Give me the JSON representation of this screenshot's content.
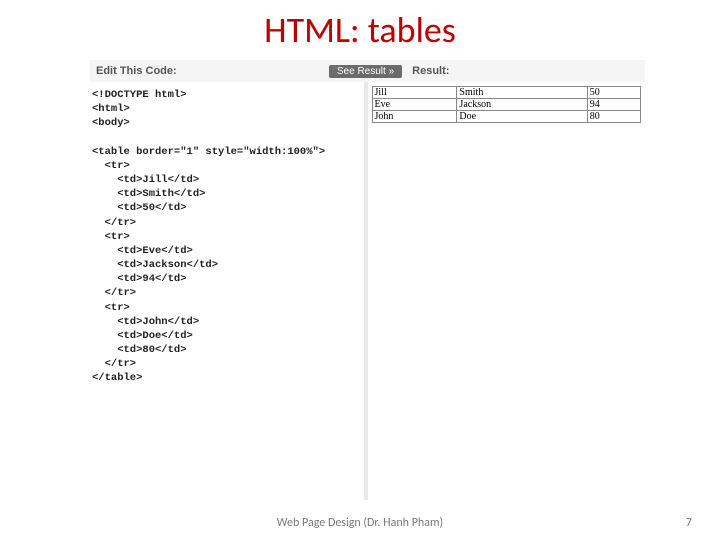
{
  "title": "HTML: tables",
  "labels": {
    "edit": "Edit This Code:",
    "see_result": "See Result »",
    "result": "Result:"
  },
  "code": "<!DOCTYPE html>\n<html>\n<body>\n\n<table border=\"1\" style=\"width:100%\">\n  <tr>\n    <td>Jill</td>\n    <td>Smith</td>\n    <td>50</td>\n  </tr>\n  <tr>\n    <td>Eve</td>\n    <td>Jackson</td>\n    <td>94</td>\n  </tr>\n  <tr>\n    <td>John</td>\n    <td>Doe</td>\n    <td>80</td>\n  </tr>\n</table>",
  "result_rows": [
    [
      "Jill",
      "Smith",
      "50"
    ],
    [
      "Eve",
      "Jackson",
      "94"
    ],
    [
      "John",
      "Doe",
      "80"
    ]
  ],
  "footer": "Web Page Design (Dr. Hanh Pham)",
  "page_number": "7"
}
